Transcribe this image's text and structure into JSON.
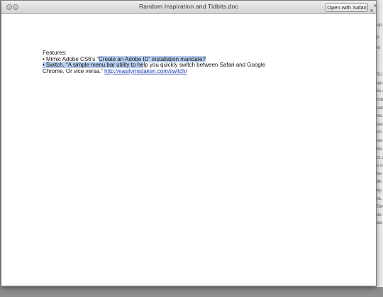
{
  "window": {
    "title": "Random Inspiration and Tidbits.doc",
    "open_button_label": "Open with Safari"
  },
  "document": {
    "heading": "Features:",
    "item1_prefix": "• Mimic Adobe CS6’s “",
    "item1_highlight": "Create an Adobe ID” installation mandate?",
    "item2_highlight": "• Switch. “A simple menu bar utility to he",
    "item2_rest": "lp you quickly switch between Safari and Google",
    "item2_line2": "Chrome. Or vice versa.” ",
    "link_text": "http://easilymistaken.com/switch/"
  },
  "background_fragments": [
    "op.",
    "p",
    "ni",
    "Tri",
    "ian.",
    "ks.c",
    "rob",
    "ualy",
    "ne.",
    "seq",
    "ch.",
    "ow",
    "bb.",
    "rs.c",
    "x.co",
    "he",
    "ith",
    "ey",
    "ra.",
    "Sev",
    "ite",
    "ea"
  ],
  "colors": {
    "highlight": "#b8cff0",
    "link": "#1a3fb3"
  }
}
